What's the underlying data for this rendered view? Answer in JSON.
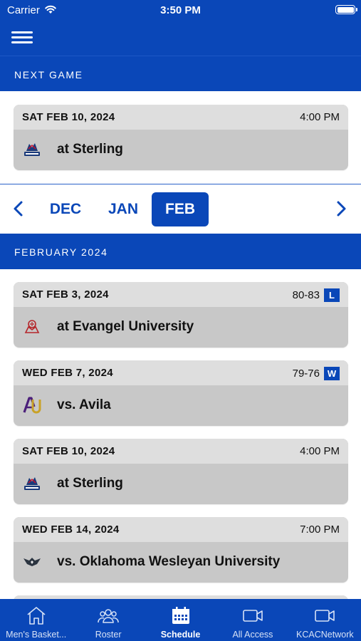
{
  "status_bar": {
    "carrier": "Carrier",
    "time": "3:50 PM"
  },
  "next_game": {
    "header": "NEXT GAME",
    "date": "SAT FEB 10, 2024",
    "time": "4:00 PM",
    "opponent": "at Sterling",
    "logo_icon": "sterling-logo-icon"
  },
  "month_nav": {
    "months": [
      "DEC",
      "JAN",
      "FEB"
    ],
    "selected": "FEB"
  },
  "month_header": "FEBRUARY 2024",
  "games": [
    {
      "date": "SAT FEB 3, 2024",
      "result": "80-83",
      "badge": "L",
      "opponent": "at Evangel University",
      "logo_icon": "evangel-logo-icon"
    },
    {
      "date": "WED FEB 7, 2024",
      "result": "79-76",
      "badge": "W",
      "opponent": "vs. Avila",
      "logo_icon": "avila-logo-icon"
    },
    {
      "date": "SAT FEB 10, 2024",
      "result": "4:00 PM",
      "badge": "",
      "opponent": "at Sterling",
      "logo_icon": "sterling-logo-icon"
    },
    {
      "date": "WED FEB 14, 2024",
      "result": "7:00 PM",
      "badge": "",
      "opponent": "vs. Oklahoma Wesleyan University",
      "logo_icon": "okwu-logo-icon"
    }
  ],
  "tabs": [
    {
      "label": "Men's Basket...",
      "icon": "home-icon"
    },
    {
      "label": "Roster",
      "icon": "people-icon"
    },
    {
      "label": "Schedule",
      "icon": "calendar-icon",
      "active": true
    },
    {
      "label": "All Access",
      "icon": "video-camera-icon"
    },
    {
      "label": "KCACNetwork",
      "icon": "video-camera-icon"
    }
  ],
  "colors": {
    "brand_blue": "#0a47b8",
    "card_head": "#dedede",
    "card_body": "#c8c8c8"
  }
}
